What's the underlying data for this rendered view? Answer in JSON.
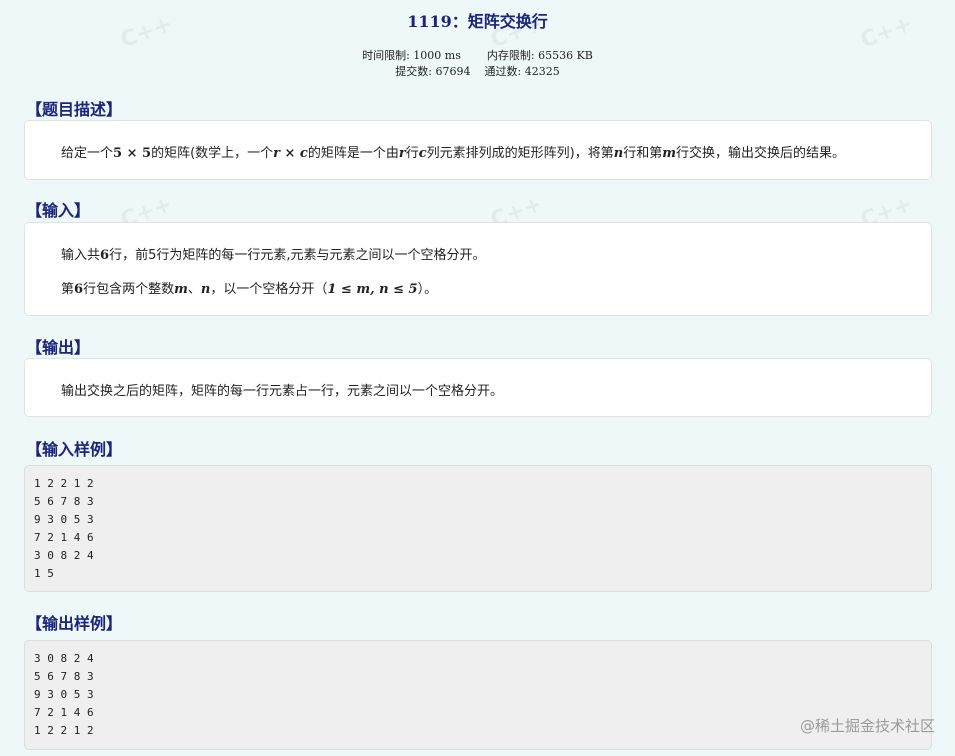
{
  "problem": {
    "title": "1119：矩阵交换行",
    "time_limit": "时间限制: 1000 ms",
    "memory_limit": "内存限制: 65536 KB",
    "submissions": "提交数: 67694",
    "accepted": "通过数: 42325"
  },
  "sections": {
    "description_title": "【题目描述】",
    "description": {
      "p1": "给定一个",
      "m1": "5 × 5",
      "p2": "的矩阵(数学上，一个",
      "m2": "r × c",
      "p3": "的矩阵是一个由",
      "m3": "r",
      "p4": "行",
      "m4": "c",
      "p5": "列元素排列成的矩形阵列)，将第",
      "m5": "n",
      "p6": "行和第",
      "m6": "m",
      "p7": "行交换，输出交换后的结果。"
    },
    "input_title": "【输入】",
    "input_line1": {
      "p1": "输入共",
      "m1": "6",
      "p2": "行，前5行为矩阵的每一行元素,元素与元素之间以一个空格分开。"
    },
    "input_line2": {
      "p1": "第",
      "m1": "6",
      "p2": "行包含两个整数",
      "m2": "m",
      "p3": "、",
      "m3": "n",
      "p4": "，以一个空格分开（",
      "m4": "1 ≤ m, n ≤ 5",
      "p5": "）。"
    },
    "output_title": "【输出】",
    "output_text": "输出交换之后的矩阵，矩阵的每一行元素占一行，元素之间以一个空格分开。",
    "sample_input_title": "【输入样例】",
    "sample_input": "1 2 2 1 2\n5 6 7 8 3\n9 3 0 5 3\n7 2 1 4 6\n3 0 8 2 4\n1 5",
    "sample_output_title": "【输出样例】",
    "sample_output": "3 0 8 2 4\n5 6 7 8 3\n9 3 0 5 3\n7 2 1 4 6\n1 2 2 1 2"
  },
  "watermark": {
    "pattern_text": "C++",
    "footer": "@稀土掘金技术社区"
  }
}
